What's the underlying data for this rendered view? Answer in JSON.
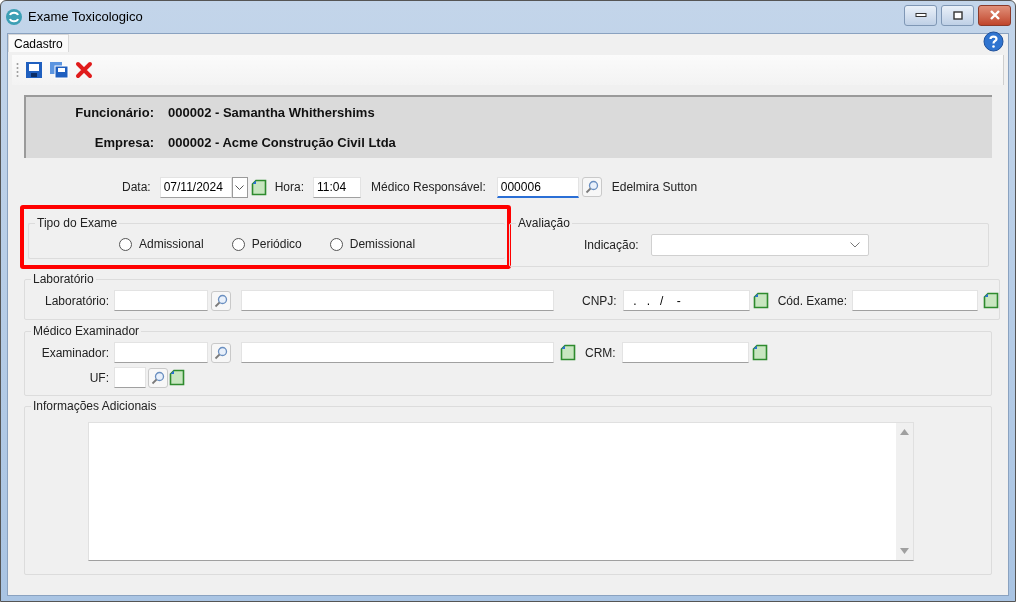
{
  "window": {
    "title": "Exame Toxicologico"
  },
  "tabs": [
    {
      "label": "Cadastro",
      "selected": true
    }
  ],
  "header": [
    {
      "label": "Funcionário:",
      "value": "000002 - Samantha Whithershims"
    },
    {
      "label": "Empresa:",
      "value": "000002 - Acme Construção Civil Ltda"
    }
  ],
  "exam_info": {
    "date_label": "Data:",
    "date": "07/11/2024",
    "time_label": "Hora:",
    "time": "11:04",
    "doctor_label": "Médico Responsável:",
    "doctor_code": "000006",
    "doctor_name": "Edelmira Sutton"
  },
  "tipo_exame": {
    "title": "Tipo do Exame",
    "highlighted": true,
    "options": [
      {
        "label": "Admissional",
        "selected": false
      },
      {
        "label": "Periódico",
        "selected": false
      },
      {
        "label": "Demissional",
        "selected": false
      }
    ]
  },
  "avaliacao": {
    "title": "Avaliação",
    "indicacao_label": "Indicação:"
  },
  "laboratorio": {
    "title": "Laboratório",
    "lab_label": "Laboratório:",
    "cnpj_label": "CNPJ:",
    "cnpj_mask": "  .   .   /    -",
    "cod_label": "Cód. Exame:"
  },
  "examinador": {
    "title": "Médico Examinador",
    "examinador_label": "Examinador:",
    "crm_label": "CRM:",
    "uf_label": "UF:"
  },
  "informacoes": {
    "title": "Informações Adicionais"
  }
}
